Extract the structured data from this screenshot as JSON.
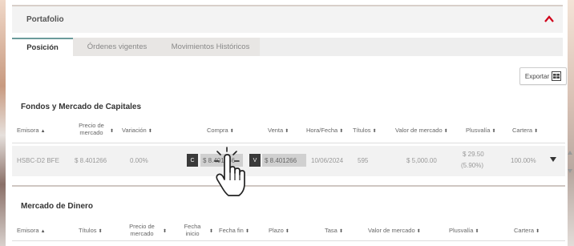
{
  "panel": {
    "title": "Portafolio"
  },
  "tabs": [
    {
      "label": "Posición",
      "active": true
    },
    {
      "label": "Órdenes vigentes",
      "active": false
    },
    {
      "label": "Movimientos Históricos",
      "active": false
    }
  ],
  "export_label": "Exportar",
  "funds": {
    "title": "Fondos y Mercado de Capitales",
    "headers": [
      "Emisora",
      "Precio de mercado",
      "Variación",
      "Compra",
      "Venta",
      "Hora/Fecha",
      "Títulos",
      "Valor de mercado",
      "Plusvalía",
      "Cartera"
    ],
    "row": {
      "emisora": "HSBC-D2 BFE",
      "precio": "$ 8.401266",
      "variacion": "0.00%",
      "compra_btn": "C",
      "compra": "$ 8.401266",
      "venta_btn": "V",
      "venta": "$ 8.401266",
      "fecha": "10/06/2024",
      "titulos": "595",
      "valor": "$ 5,000.00",
      "plusvalia_amount": "$ 29.50",
      "plusvalia_pct": "(5.90%)",
      "cartera": "100.00%"
    }
  },
  "money": {
    "title": "Mercado de Dinero",
    "headers": [
      "Emisora",
      "Títulos",
      "Precio de mercado",
      "Fecha inicio",
      "Fecha fin",
      "Plazo",
      "Tasa",
      "Valor de mercado",
      "Plusvalía",
      "Cartera"
    ]
  },
  "colors": {
    "accent_red": "#d0021b",
    "tab_teal": "#6b9b9b"
  }
}
